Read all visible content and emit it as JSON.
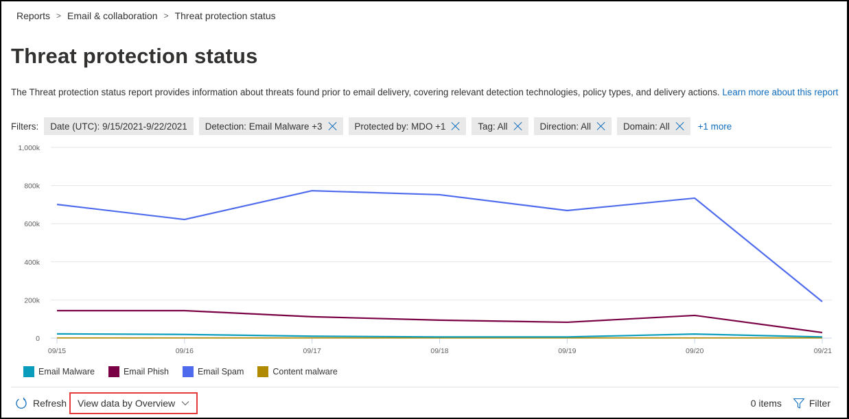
{
  "breadcrumb": [
    "Reports",
    "Email & collaboration",
    "Threat protection status"
  ],
  "page_title": "Threat protection status",
  "description": {
    "text": "The Threat protection status report provides information about threats found prior to email delivery, covering relevant detection technologies, policy types, and delivery actions. ",
    "link": "Learn more about this report"
  },
  "filters": {
    "label": "Filters:",
    "chips": [
      {
        "label": "Date (UTC): 9/15/2021-9/22/2021",
        "removable": false
      },
      {
        "label": "Detection: Email Malware +3",
        "removable": true
      },
      {
        "label": "Protected by: MDO +1",
        "removable": true
      },
      {
        "label": "Tag: All",
        "removable": true
      },
      {
        "label": "Direction: All",
        "removable": true
      },
      {
        "label": "Domain: All",
        "removable": true
      }
    ],
    "more": "+1 more"
  },
  "colors": {
    "accent": "#0f6cbd",
    "highlight_border": "#e5383b"
  },
  "chart_data": {
    "type": "line",
    "title": "",
    "xlabel": "",
    "ylabel": "",
    "x": [
      "09/15",
      "09/16",
      "09/17",
      "09/18",
      "09/19",
      "09/20",
      "09/21"
    ],
    "ylim": [
      0,
      1000000
    ],
    "yticks": [
      0,
      200000,
      400000,
      600000,
      800000,
      1000000
    ],
    "ytick_labels": [
      "0",
      "200k",
      "400k",
      "600k",
      "800k",
      "1,000k"
    ],
    "grid": true,
    "legend_position": "bottom-left",
    "series": [
      {
        "name": "Email Malware",
        "color": "#0a9dbb",
        "values": [
          22000,
          19000,
          10000,
          6000,
          6000,
          21000,
          6000
        ]
      },
      {
        "name": "Email Phish",
        "color": "#7a0045",
        "values": [
          144000,
          144000,
          112000,
          94000,
          83000,
          119000,
          29000
        ]
      },
      {
        "name": "Email Spam",
        "color": "#4f6bed",
        "values": [
          701000,
          622000,
          773000,
          752000,
          669000,
          734000,
          191000
        ]
      },
      {
        "name": "Content malware",
        "color": "#b08a00",
        "values": [
          1000,
          1000,
          1000,
          1000,
          1000,
          1000,
          1000
        ]
      }
    ]
  },
  "toolbar": {
    "refresh": "Refresh",
    "view_by": "View data by Overview",
    "items_count": "0 items",
    "filter": "Filter"
  }
}
